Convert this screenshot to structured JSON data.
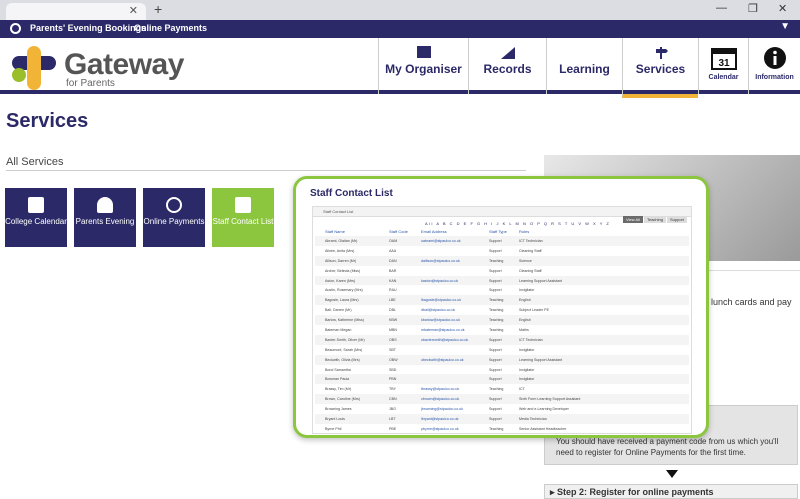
{
  "app": {
    "links": [
      "Parents' Evening Bookings",
      "Online Payments"
    ],
    "brand": "Gateway",
    "brand_sub": "for Parents"
  },
  "nav": [
    {
      "label": "My Organiser",
      "icon": "grid-icon"
    },
    {
      "label": "Records",
      "icon": "chart-icon"
    },
    {
      "label": "Learning",
      "icon": "book-icon"
    },
    {
      "label": "Services",
      "icon": "signpost-icon"
    },
    {
      "label": "Calendar",
      "icon": "calendar-icon",
      "day": "31"
    },
    {
      "label": "Information",
      "icon": "info-icon"
    }
  ],
  "page": {
    "title": "Services",
    "section": "All Services",
    "tiles": [
      {
        "label": "College Calendar",
        "icon": "calendar-icon"
      },
      {
        "label": "Parents Evening",
        "icon": "person-icon"
      },
      {
        "label": "Online Payments",
        "icon": "gauge-icon"
      },
      {
        "label": "Staff Contact List",
        "icon": "contact-card-icon"
      }
    ],
    "right_text": "lunch cards and pay",
    "step1_text": "You should have received a payment code from us which you'll need to register for Online Payments for the first time.",
    "step2_text": "Step 2: Register for online payments"
  },
  "popup": {
    "title": "Staff Contact List",
    "inner_title": "Staff Contact List",
    "buttons": [
      "View All",
      "Teaching",
      "Support"
    ],
    "alphabet": "All A B C D E F G H I J K L M N O P Q R S T U V W X Y Z",
    "columns": [
      "Staff Name",
      "Staff Code",
      "Email Address",
      "Staff Type",
      "Roles"
    ],
    "rows": [
      [
        "Abrami, Olaitan (Mr)",
        "OAM",
        "oabrami@stpaulco.co.uk",
        "Support",
        "ICT Technician"
      ],
      [
        "Allnee, Anita (Mrs)",
        "AAA",
        "",
        "Support",
        "Cleaning Staff"
      ],
      [
        "Allison, Darren (Mr)",
        "DAN",
        "dallison@stpaulco.co.uk",
        "Teaching",
        "Science"
      ],
      [
        "Archer, Belinda (Miss)",
        "BAR",
        "",
        "Support",
        "Cleaning Staff"
      ],
      [
        "Aston, Karen (Mrs)",
        "KAN",
        "kaston@stpaulco.co.uk",
        "Support",
        "Learning Support Assistant"
      ],
      [
        "Austin, Rosemary (Mrs)",
        "RAU",
        "",
        "Support",
        "Invigilator"
      ],
      [
        "Bagosle, Laura (Mrs)",
        "LBE",
        "lbagosle@stpaulco.co.uk",
        "Teaching",
        "English"
      ],
      [
        "Ball, Darren (Mr)",
        "DBL",
        "dball@stpaulco.co.uk",
        "Teaching",
        "Subject Leader PE"
      ],
      [
        "Barlow, Katherine (Miss)",
        "KBW",
        "kbarlow@stpaulco.co.uk",
        "Teaching",
        "English"
      ],
      [
        "Bateman Megan",
        "MBN",
        "mbateman@stpaulco.co.uk",
        "Teaching",
        "Maths"
      ],
      [
        "Baxter-Smith, Oliver (Mr)",
        "OBS",
        "obaxtersmith@stpaulco.co.uk",
        "Support",
        "ICT Technician"
      ],
      [
        "Beaumont, Sarah (Mrs)",
        "SBT",
        "",
        "Support",
        "Invigilator"
      ],
      [
        "Beckwith, Olivia (Mrs)",
        "OBW",
        "obeckwith@stpaulco.co.uk",
        "Support",
        "Learning Support Assistant"
      ],
      [
        "Bond Samantha",
        "SBD",
        "",
        "Support",
        "Invigilator"
      ],
      [
        "Bowman Paula",
        "PBN",
        "",
        "Support",
        "Invigilator"
      ],
      [
        "Brassy, Tim (Mr)",
        "TBY",
        "tbrassy@stpaulco.co.uk",
        "Teaching",
        "ICT"
      ],
      [
        "Brown, Caroline (Mrs)",
        "CBN",
        "cbrown@stpaulco.co.uk",
        "Support",
        "Sixth Form Learning Support Assistant"
      ],
      [
        "Browning James",
        "JBG",
        "jbrowning@stpaulco.co.uk",
        "Support",
        "Web and e-Learning Developer"
      ],
      [
        "Bryant Louis",
        "LBT",
        "lbryant@stpaulco.co.uk",
        "Support",
        "Media Technician"
      ],
      [
        "Byrne Phil",
        "PBE",
        "pbyrne@stpaulco.co.uk",
        "Teaching",
        "Senior Assistant Headteacher"
      ]
    ]
  },
  "colors": {
    "brand_navy": "#2b2967",
    "accent_yellow": "#f1b436",
    "accent_green": "#8cc63f"
  }
}
